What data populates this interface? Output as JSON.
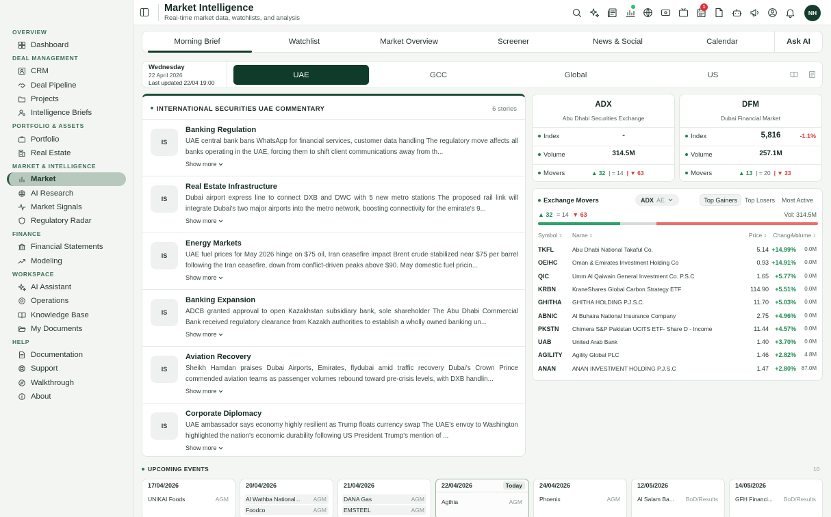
{
  "sidebar": {
    "sections": [
      {
        "title": "OVERVIEW",
        "items": [
          {
            "label": "Dashboard",
            "icon": "grid-icon"
          }
        ]
      },
      {
        "title": "DEAL MANAGEMENT",
        "items": [
          {
            "label": "CRM",
            "icon": "contact-icon"
          },
          {
            "label": "Deal Pipeline",
            "icon": "handshake-icon"
          },
          {
            "label": "Projects",
            "icon": "folder-icon"
          },
          {
            "label": "Intelligence Briefs",
            "icon": "user-search-icon"
          }
        ]
      },
      {
        "title": "PORTFOLIO & ASSETS",
        "items": [
          {
            "label": "Portfolio",
            "icon": "briefcase-icon"
          },
          {
            "label": "Real Estate",
            "icon": "building-icon"
          }
        ]
      },
      {
        "title": "MARKET & INTELLIGENCE",
        "items": [
          {
            "label": "Market",
            "icon": "bar-chart-icon",
            "active": true
          },
          {
            "label": "AI Research",
            "icon": "brain-icon"
          },
          {
            "label": "Market Signals",
            "icon": "pulse-icon"
          },
          {
            "label": "Regulatory Radar",
            "icon": "shield-icon"
          }
        ]
      },
      {
        "title": "FINANCE",
        "items": [
          {
            "label": "Financial Statements",
            "icon": "bank-icon"
          },
          {
            "label": "Modeling",
            "icon": "trend-icon"
          }
        ]
      },
      {
        "title": "WORKSPACE",
        "items": [
          {
            "label": "AI Assistant",
            "icon": "sparkle-icon"
          },
          {
            "label": "Operations",
            "icon": "gear-icon"
          },
          {
            "label": "Knowledge Base",
            "icon": "book-icon"
          },
          {
            "label": "My Documents",
            "icon": "folder-open-icon"
          }
        ]
      },
      {
        "title": "HELP",
        "items": [
          {
            "label": "Documentation",
            "icon": "document-icon"
          },
          {
            "label": "Support",
            "icon": "lifebuoy-icon"
          },
          {
            "label": "Walkthrough",
            "icon": "compass-icon"
          },
          {
            "label": "About",
            "icon": "info-icon"
          }
        ]
      }
    ]
  },
  "header": {
    "title": "Market Intelligence",
    "subtitle": "Real-time market data, watchlists, and analysis",
    "avatar": "NH",
    "notification_count": "1",
    "icons": [
      "search-icon",
      "sparkle-icon",
      "newspaper-icon",
      "chart-icon",
      "globe-icon",
      "ticket-icon",
      "tv-icon",
      "calendar-icon",
      "file-icon",
      "bot-icon",
      "megaphone-icon",
      "user-circle-icon",
      "bell-icon"
    ]
  },
  "tabs": [
    "Morning Brief",
    "Watchlist",
    "Market Overview",
    "Screener",
    "News & Social",
    "Calendar"
  ],
  "ask_ai": "Ask AI",
  "region": {
    "day": "Wednesday",
    "date": "22 April 2026",
    "updated": "Last updated 22/04 19:00",
    "options": [
      "UAE",
      "GCC",
      "Global",
      "US"
    ],
    "selected": "UAE"
  },
  "commentary": {
    "title": "INTERNATIONAL SECURITIES UAE COMMENTARY",
    "count": "6 stories",
    "show_more": "Show more",
    "stories": [
      {
        "avatar": "IS",
        "title": "Banking Regulation",
        "text": "UAE central bank bans WhatsApp for financial services, customer data handling The regulatory move affects all banks operating in the UAE, forcing them to shift client communications away from th..."
      },
      {
        "avatar": "IS",
        "title": "Real Estate Infrastructure",
        "text": "Dubai airport express line to connect DXB and DWC with 5 new metro stations The proposed rail link will integrate Dubai's two major airports into the metro network, boosting connectivity for the emirate's 9..."
      },
      {
        "avatar": "IS",
        "title": "Energy Markets",
        "text": "UAE fuel prices for May 2026 hinge on $75 oil, Iran ceasefire impact Brent crude stabilized near $75 per barrel following the Iran ceasefire, down from conflict-driven peaks above $90. May domestic fuel pricin..."
      },
      {
        "avatar": "IS",
        "title": "Banking Expansion",
        "text": "ADCB granted approval to open Kazakhstan subsidiary bank, sole shareholder The Abu Dhabi Commercial Bank received regulatory clearance from Kazakh authorities to establish a wholly owned banking un..."
      },
      {
        "avatar": "IS",
        "title": "Aviation Recovery",
        "text": "Sheikh Hamdan praises Dubai Airports, Emirates, flydubai amid traffic recovery Dubai's Crown Prince commended aviation teams as passenger volumes rebound toward pre-crisis levels, with DXB handlin..."
      },
      {
        "avatar": "IS",
        "title": "Corporate Diplomacy",
        "text": "UAE ambassador says economy highly resilient as Trump floats currency swap The UAE's envoy to Washington highlighted the nation's economic durability following US President Trump's mention of ..."
      }
    ]
  },
  "exchanges": [
    {
      "code": "ADX",
      "name": "Abu Dhabi Securities Exchange",
      "index": "-",
      "index_change": "",
      "volume": "314.5M",
      "up": "32",
      "flat": "14",
      "down": "63"
    },
    {
      "code": "DFM",
      "name": "Dubai Financial Market",
      "index": "5,816",
      "index_change": "-1.1%",
      "volume": "257.1M",
      "up": "13",
      "flat": "20",
      "down": "33"
    }
  ],
  "labels": {
    "index": "Index",
    "volume": "Volume",
    "movers": "Movers"
  },
  "movers": {
    "title": "Exchange Movers",
    "exchange": "ADX",
    "country": "AE",
    "tabs": [
      "Top Gainers",
      "Top Losers",
      "Most Active"
    ],
    "up": "32",
    "flat": "14",
    "down": "63",
    "vol_label": "Vol: 314.5M",
    "breadth": {
      "up": 32,
      "flat": 14,
      "down": 63
    },
    "columns": [
      "Symbol",
      "Name",
      "Price",
      "Change",
      "Volume"
    ],
    "rows": [
      {
        "symbol": "TKFL",
        "name": "Abu Dhabi National Takaful Co.",
        "price": "5.14",
        "change": "+14.99%",
        "volume": "0.0M"
      },
      {
        "symbol": "OEIHC",
        "name": "Oman & Emirates Investment Holding Co",
        "price": "0.93",
        "change": "+14.91%",
        "volume": "0.0M"
      },
      {
        "symbol": "QIC",
        "name": "Umm Al Qaiwain General Investment Co. P.S.C",
        "price": "1.65",
        "change": "+5.77%",
        "volume": "0.0M"
      },
      {
        "symbol": "KRBN",
        "name": "KraneShares Global Carbon Strategy ETF",
        "price": "114.90",
        "change": "+5.51%",
        "volume": "0.0M"
      },
      {
        "symbol": "GHITHA",
        "name": "GHITHA HOLDING P.J.S.C.",
        "price": "11.70",
        "change": "+5.03%",
        "volume": "0.0M"
      },
      {
        "symbol": "ABNIC",
        "name": "Al Buhaira National Insurance Company",
        "price": "2.75",
        "change": "+4.96%",
        "volume": "0.0M"
      },
      {
        "symbol": "PKSTN",
        "name": "Chimera S&P Pakistan UCITS ETF- Share D - Income",
        "price": "11.44",
        "change": "+4.57%",
        "volume": "0.0M"
      },
      {
        "symbol": "UAB",
        "name": "United Arab Bank",
        "price": "1.40",
        "change": "+3.70%",
        "volume": "0.0M"
      },
      {
        "symbol": "AGILITY",
        "name": "Agility Global PLC",
        "price": "1.46",
        "change": "+2.82%",
        "volume": "4.8M"
      },
      {
        "symbol": "ANAN",
        "name": "ANAN INVESTMENT HOLDING P.J.S.C",
        "price": "1.47",
        "change": "+2.80%",
        "volume": "87.0M"
      }
    ]
  },
  "events": {
    "title": "UPCOMING EVENTS",
    "count": "10",
    "today_label": "Today",
    "days": [
      {
        "date": "17/04/2026",
        "items": [
          {
            "name": "UNIKAI Foods",
            "type": "AGM"
          }
        ]
      },
      {
        "date": "20/04/2026",
        "items": [
          {
            "name": "Al Wathba National...",
            "type": "AGM"
          },
          {
            "name": "Foodco",
            "type": "AGM"
          }
        ]
      },
      {
        "date": "21/04/2026",
        "items": [
          {
            "name": "DANA Gas",
            "type": "AGM"
          },
          {
            "name": "EMSTEEL",
            "type": "AGM"
          }
        ]
      },
      {
        "date": "22/04/2026",
        "today": true,
        "items": [
          {
            "name": "Agthia",
            "type": "AGM"
          }
        ]
      },
      {
        "date": "24/04/2026",
        "items": [
          {
            "name": "Phoenix",
            "type": "AGM"
          }
        ]
      },
      {
        "date": "12/05/2026",
        "items": [
          {
            "name": "Al Salam Ba...",
            "type": "BoD/Results"
          }
        ]
      },
      {
        "date": "14/05/2026",
        "items": [
          {
            "name": "GFH Financi...",
            "type": "BoD/Results"
          }
        ]
      }
    ]
  }
}
